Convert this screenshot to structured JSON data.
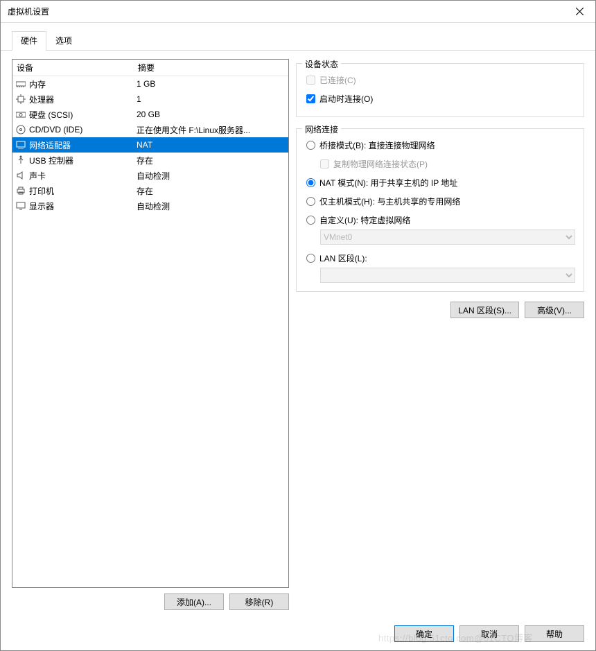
{
  "window_title": "虚拟机设置",
  "tabs": {
    "hardware": "硬件",
    "options": "选项"
  },
  "list": {
    "col_device": "设备",
    "col_summary": "摘要",
    "rows": [
      {
        "name": "内存",
        "summary": "1 GB",
        "icon": "memory-icon"
      },
      {
        "name": "处理器",
        "summary": "1",
        "icon": "cpu-icon"
      },
      {
        "name": "硬盘 (SCSI)",
        "summary": "20 GB",
        "icon": "hdd-icon"
      },
      {
        "name": "CD/DVD (IDE)",
        "summary": "正在使用文件 F:\\Linux服务器...",
        "icon": "disc-icon"
      },
      {
        "name": "网络适配器",
        "summary": "NAT",
        "icon": "network-icon"
      },
      {
        "name": "USB 控制器",
        "summary": "存在",
        "icon": "usb-icon"
      },
      {
        "name": "声卡",
        "summary": "自动检测",
        "icon": "sound-icon"
      },
      {
        "name": "打印机",
        "summary": "存在",
        "icon": "printer-icon"
      },
      {
        "name": "显示器",
        "summary": "自动检测",
        "icon": "display-icon"
      }
    ]
  },
  "buttons": {
    "add": "添加(A)...",
    "remove": "移除(R)",
    "lan_segments": "LAN 区段(S)...",
    "advanced": "高级(V)...",
    "ok": "确定",
    "cancel": "取消",
    "help": "帮助"
  },
  "groups": {
    "device_state": {
      "title": "设备状态",
      "connected": "已连接(C)",
      "connect_at_power": "启动时连接(O)"
    },
    "net_conn": {
      "title": "网络连接",
      "bridged": "桥接模式(B): 直接连接物理网络",
      "replicate": "复制物理网络连接状态(P)",
      "nat": "NAT 模式(N): 用于共享主机的 IP 地址",
      "hostonly": "仅主机模式(H): 与主机共享的专用网络",
      "custom": "自定义(U): 特定虚拟网络",
      "custom_value": "VMnet0",
      "lan_seg": "LAN 区段(L):",
      "lan_seg_value": ""
    }
  },
  "watermark": "https://blog.51cto.com@51CTO博客"
}
